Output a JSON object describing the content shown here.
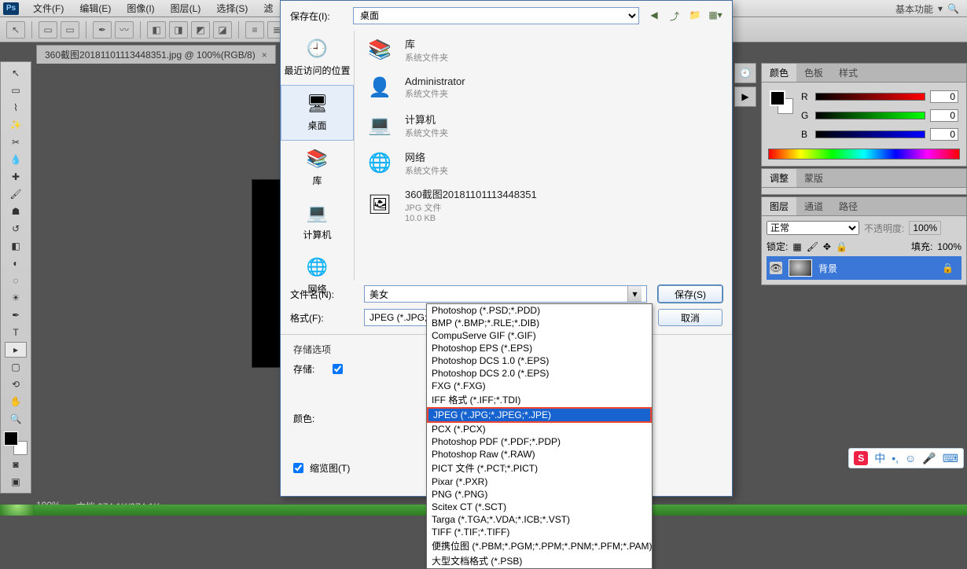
{
  "menu": {
    "file": "文件(F)",
    "edit": "编辑(E)",
    "image": "图像(I)",
    "layer": "图层(L)",
    "select": "选择(S)",
    "filter": "滤"
  },
  "workspace": {
    "label": "基本功能"
  },
  "doctab": {
    "title": "360截图20181101113448351.jpg @ 100%(RGB/8)",
    "close": "×"
  },
  "status": {
    "zoom": "100%",
    "docinfo": "文档:274.1K/274.1K"
  },
  "panels": {
    "color": {
      "tab_color": "颜色",
      "tab_swatch": "色板",
      "tab_style": "样式",
      "r": "R",
      "g": "G",
      "b": "B",
      "rv": "0",
      "gv": "0",
      "bv": "0"
    },
    "adjust": {
      "tab_adjust": "调整",
      "tab_mask": "蒙版"
    },
    "layers": {
      "tab_layer": "图层",
      "tab_channel": "通道",
      "tab_path": "路径",
      "blend": "正常",
      "opacity_lab": "不透明度:",
      "opacity_val": "100%",
      "lock_lab": "锁定:",
      "fill_lab": "填充:",
      "fill_val": "100%",
      "layer0": "背景"
    }
  },
  "dialog": {
    "saveIn_lab": "保存在(I):",
    "saveIn_val": "桌面",
    "places": {
      "recent": "最近访问的位置",
      "desktop": "桌面",
      "libraries": "库",
      "computer": "计算机",
      "network": "网络"
    },
    "list": {
      "lib": {
        "name": "库",
        "sub": "系统文件夹"
      },
      "admin": {
        "name": "Administrator",
        "sub": "系统文件夹"
      },
      "comp": {
        "name": "计算机",
        "sub": "系统文件夹"
      },
      "net": {
        "name": "网络",
        "sub": "系统文件夹"
      },
      "img": {
        "name": "360截图20181101113448351",
        "sub": "JPG 文件",
        "size": "10.0 KB"
      }
    },
    "fname_lab": "文件名(N):",
    "fname_val": "美女",
    "fmt_lab": "格式(F):",
    "fmt_val": "JPEG (*.JPG;*.JPEG;*.JPE)",
    "save_btn": "保存(S)",
    "cancel_btn": "取消",
    "opts_title": "存储选项",
    "opts_save": "存储:",
    "opts_color": "颜色:",
    "thumb": "缩览图(T)"
  },
  "formats": [
    "Photoshop (*.PSD;*.PDD)",
    "BMP (*.BMP;*.RLE;*.DIB)",
    "CompuServe GIF (*.GIF)",
    "Photoshop EPS (*.EPS)",
    "Photoshop DCS 1.0 (*.EPS)",
    "Photoshop DCS 2.0 (*.EPS)",
    "FXG (*.FXG)",
    "IFF 格式 (*.IFF;*.TDI)",
    "JPEG (*.JPG;*.JPEG;*.JPE)",
    "PCX (*.PCX)",
    "Photoshop PDF (*.PDF;*.PDP)",
    "Photoshop Raw (*.RAW)",
    "PICT 文件 (*.PCT;*.PICT)",
    "Pixar (*.PXR)",
    "PNG (*.PNG)",
    "Scitex CT (*.SCT)",
    "Targa (*.TGA;*.VDA;*.ICB;*.VST)",
    "TIFF (*.TIF;*.TIFF)",
    "便携位图 (*.PBM;*.PGM;*.PPM;*.PNM;*.PFM;*.PAM)",
    "大型文档格式 (*.PSB)"
  ],
  "format_selected_index": 8,
  "ime": {
    "brand": "S",
    "lang": "中"
  }
}
